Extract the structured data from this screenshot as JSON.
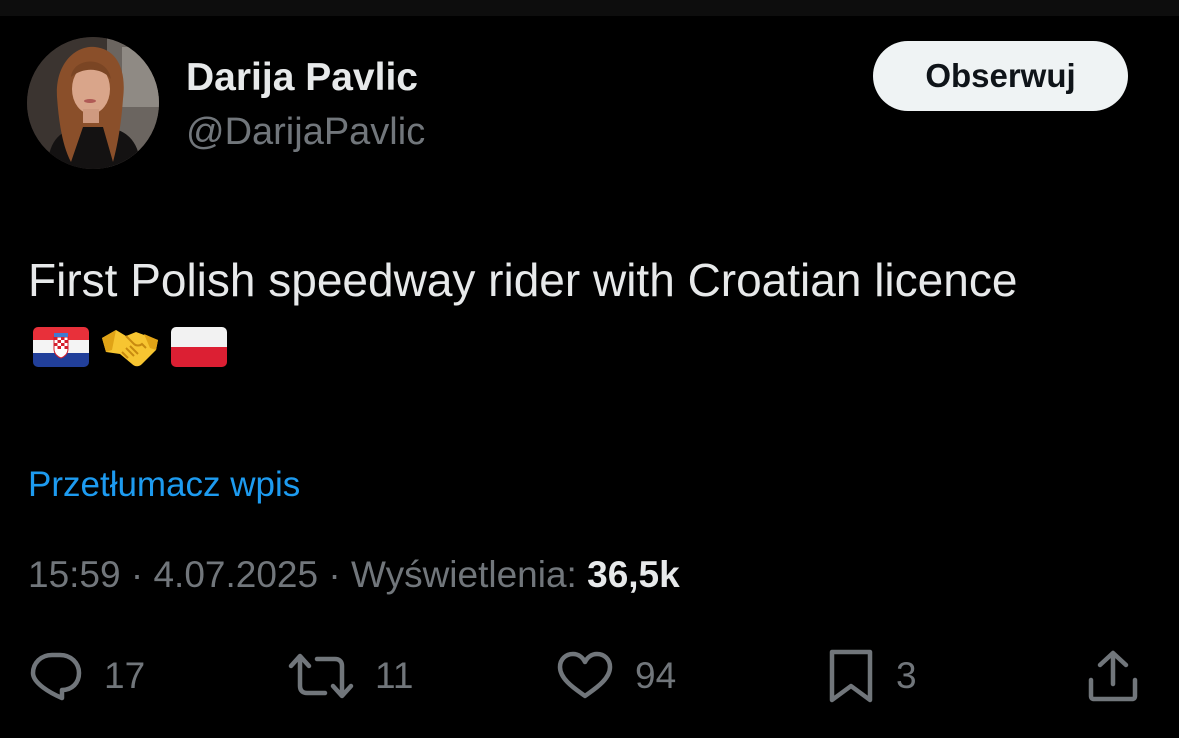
{
  "author": {
    "display_name": "Darija Pavlic",
    "handle": "@DarijaPavlic"
  },
  "follow_button": {
    "label": "Obserwuj"
  },
  "tweet": {
    "text": "First Polish speedway rider with Croatian licence",
    "emojis": [
      "croatia-flag",
      "handshake",
      "poland-flag"
    ]
  },
  "translate_link": "Przetłumacz wpis",
  "meta": {
    "time": "15:59",
    "separator": "·",
    "date": "4.07.2025",
    "views_label": "Wyświetlenia:",
    "views_count": "36,5k"
  },
  "actions": {
    "replies": "17",
    "reposts": "11",
    "likes": "94",
    "bookmarks": "3"
  },
  "colors": {
    "background": "#000000",
    "primary_text": "#e7e9ea",
    "secondary_text": "#71767b",
    "link": "#1d9bf0",
    "follow_button_bg": "#eff3f4"
  }
}
